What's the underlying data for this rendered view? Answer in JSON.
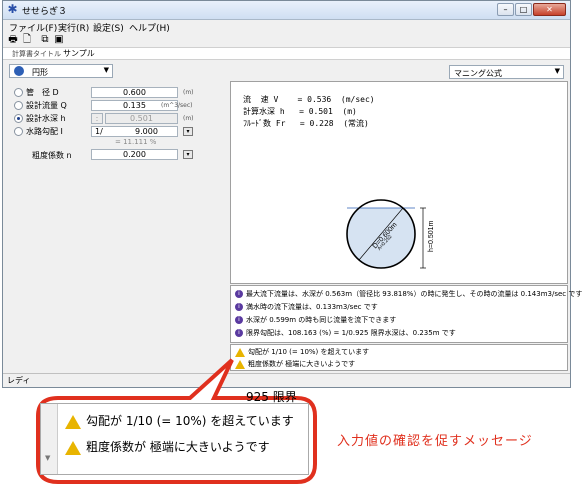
{
  "window": {
    "title": "せせらぎ３"
  },
  "menu": [
    "ファイル(F)",
    "実行(R)",
    "設定(S)",
    "ヘルプ(H)"
  ],
  "calc_title": {
    "label": "計算書タイトル",
    "value": "サンプル"
  },
  "section": {
    "value": "円形"
  },
  "formula": {
    "value": "マニング公式"
  },
  "params": [
    {
      "label": "管　径 D",
      "value": "0.600",
      "unit": "(m)",
      "selected": false
    },
    {
      "label": "設計流量 Q",
      "value": "0.135",
      "unit": "(m^3/sec)",
      "selected": false
    },
    {
      "label": "設計水深 h",
      "value": "0.501",
      "unit": "(m)",
      "selected": true
    },
    {
      "label": "水路勾配 I",
      "prefix": "1/",
      "value": "9.000",
      "unit": "",
      "selected": false
    }
  ],
  "slope_note": "= 11.111 %",
  "roughness": {
    "label": "粗度係数 n",
    "value": "0.200"
  },
  "results": [
    "流  速 V    = 0.536  (m/sec)",
    "計算水深 h   = 0.501  (m)",
    "ﾌﾙｰﾄﾞ数 Fr   = 0.228  (常流)"
  ],
  "diagram": {
    "diameter_label": "D=0.600m",
    "depth_label": "h=0.501m",
    "area_label": "A=0.252"
  },
  "info": [
    "最大流下流量は、水深が 0.563m（管径比 93.818%）の時に発生し、その時の流量は 0.143m3/sec です",
    "満水時の流下流量は、0.133m3/sec です",
    "水深が 0.599m の時も同じ流量を流下できます",
    "限界勾配は、108.163 (%) = 1/0.925 限界水深は、0.235m です"
  ],
  "warnings": [
    "勾配が 1/10 (= 10%) を超えています",
    "粗度係数が 極端に大きいようです"
  ],
  "behind_text": "925 限界",
  "status": "レディ",
  "caption": "入力値の確認を促すメッセージ",
  "colors": {
    "accent": "#2d5fb5",
    "callout": "#e0301e",
    "warning": "#e8b400"
  }
}
